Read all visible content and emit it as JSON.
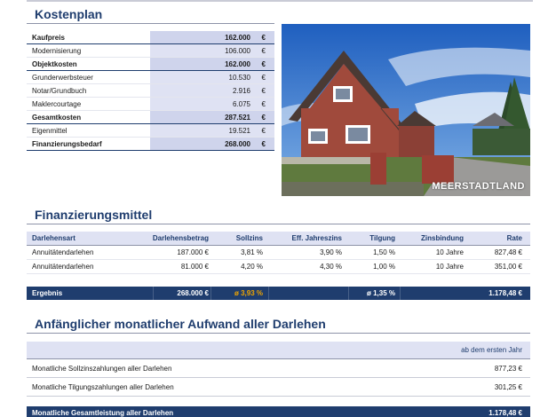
{
  "kostenplan": {
    "title": "Kostenplan",
    "rows": [
      {
        "label": "Kaufpreis",
        "value": "162.000",
        "currency": "€",
        "strong": true
      },
      {
        "label": "Modernisierung",
        "value": "106.000",
        "currency": "€",
        "strong": false
      },
      {
        "label": "Objektkosten",
        "value": "162.000",
        "currency": "€",
        "strong": true
      },
      {
        "label": "Grunderwerbsteuer",
        "value": "10.530",
        "currency": "€",
        "strong": false
      },
      {
        "label": "Notar/Grundbuch",
        "value": "2.916",
        "currency": "€",
        "strong": false
      },
      {
        "label": "Maklercourtage",
        "value": "6.075",
        "currency": "€",
        "strong": false
      },
      {
        "label": "Gesamtkosten",
        "value": "287.521",
        "currency": "€",
        "strong": true
      },
      {
        "label": "Eigenmittel",
        "value": "19.521",
        "currency": "€",
        "strong": false
      },
      {
        "label": "Finanzierungsbedarf",
        "value": "268.000",
        "currency": "€",
        "strong": true
      }
    ]
  },
  "photo": {
    "watermark": "MEERSTADTLAND",
    "sky_color": "#2f6fc9",
    "roof_color": "#4a3a34",
    "brick_color": "#a04a3c"
  },
  "finanzierungsmittel": {
    "title": "Finanzierungsmittel",
    "headers": [
      "Darlehensart",
      "Darlehensbetrag",
      "Sollzins",
      "Eff. Jahreszins",
      "Tilgung",
      "Zinsbindung",
      "Rate"
    ],
    "rows": [
      [
        "Annuitätendarlehen",
        "187.000 €",
        "3,81 %",
        "3,90 %",
        "1,50 %",
        "10 Jahre",
        "827,48 €"
      ],
      [
        "Annuitätendarlehen",
        "81.000 €",
        "4,20 %",
        "4,30 %",
        "1,00 %",
        "10 Jahre",
        "351,00 €"
      ]
    ],
    "total": {
      "label": "Ergebnis",
      "amount": "268.000 €",
      "sollzins": "ø 3,93 %",
      "tilgung": "ø 1,35 %",
      "rate": "1.178,48 €"
    }
  },
  "aufwand": {
    "title": "Anfänglicher monatlicher Aufwand aller Darlehen",
    "column": "ab dem ersten Jahr",
    "rows": [
      {
        "label": "Monatliche Sollzinszahlungen aller Darlehen",
        "value": "877,23 €"
      },
      {
        "label": "Monatliche Tilgungszahlungen aller Darlehen",
        "value": "301,25 €"
      }
    ],
    "total": {
      "label": "Monatliche Gesamtleistung aller Darlehen",
      "value": "1.178,48 €"
    }
  },
  "colors": {
    "accent": "#1f3d6e",
    "highlight": "#f0a500",
    "value_bg": "#dfe2f3"
  }
}
